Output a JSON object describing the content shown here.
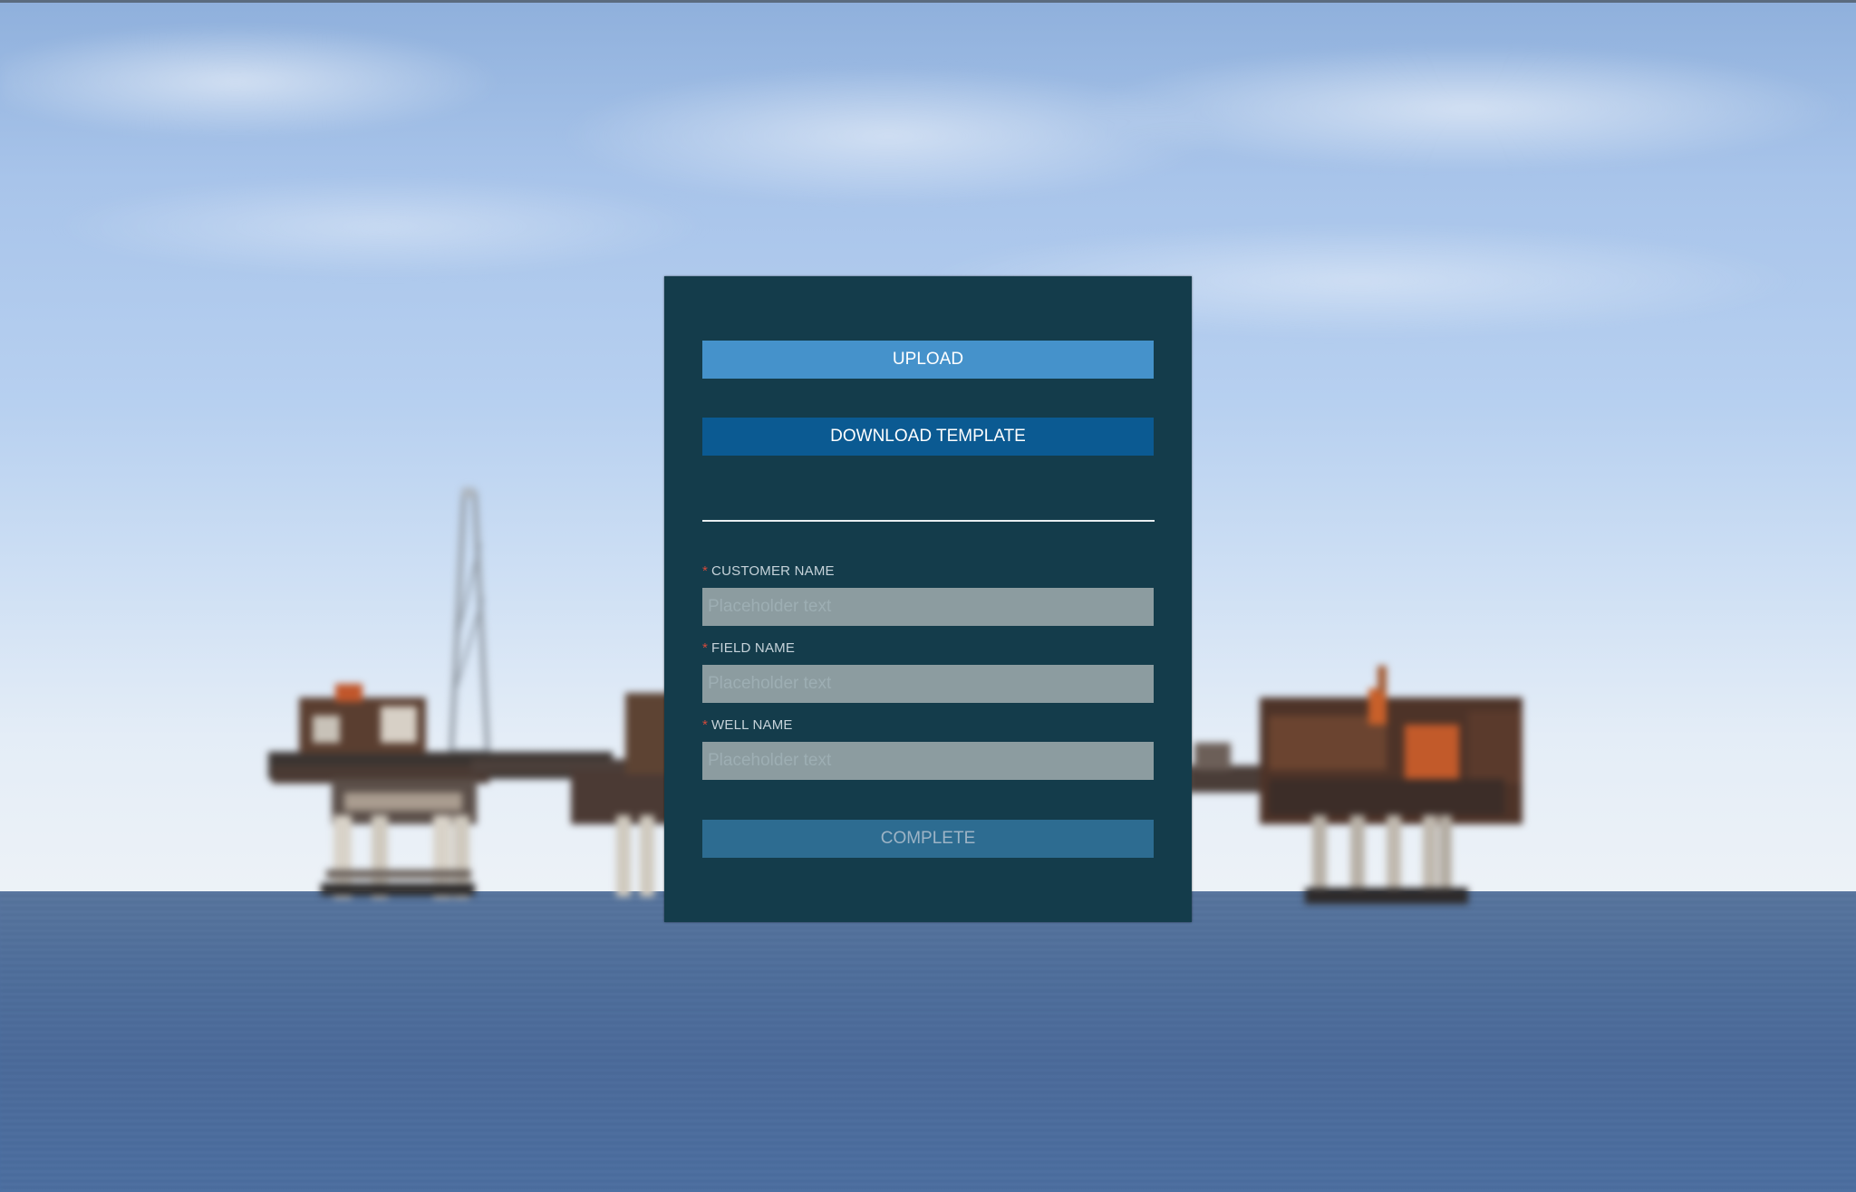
{
  "form": {
    "upload_label": "UPLOAD",
    "download_template_label": "DOWNLOAD TEMPLATE",
    "complete_label": "COMPLETE",
    "required_marker": "*",
    "fields": [
      {
        "label": "CUSTOMER NAME",
        "placeholder": "Placeholder text",
        "value": ""
      },
      {
        "label": "FIELD NAME",
        "placeholder": "Placeholder text",
        "value": ""
      },
      {
        "label": "WELL NAME",
        "placeholder": "Placeholder text",
        "value": ""
      }
    ]
  },
  "colors": {
    "panel_background": "#143c4b",
    "upload_button": "#4592cb",
    "download_button": "#0b5a92",
    "complete_button": "#2d6c91",
    "required_marker": "#d34a3c",
    "input_background": "#8c9ca0"
  },
  "background": {
    "scene": "blurred offshore oil platforms at sea under a cloudy sky"
  }
}
